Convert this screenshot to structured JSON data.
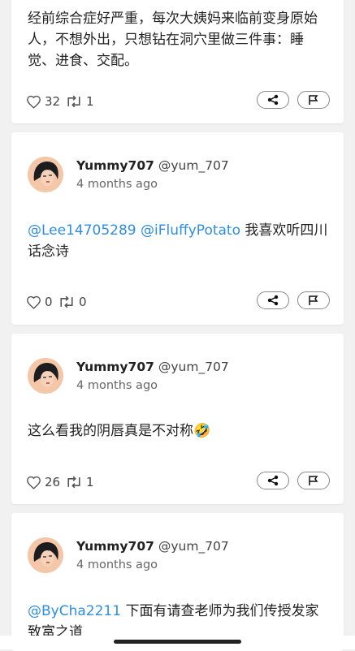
{
  "card0": {
    "text": "经前综合症好严重，每次大姨妈来临前变身原始人，不想外出，只想钻在洞穴里做三件事：睡觉、进食、交配。",
    "likes": "32",
    "reposts": "1"
  },
  "posts": [
    {
      "author_name": "Yummy707",
      "author_handle": "@yum_707",
      "time": "4 months ago",
      "mention1": "@Lee14705289",
      "mention2": "@iFluffyPotato",
      "text": "我喜欢听四川话念诗",
      "likes": "0",
      "reposts": "0"
    },
    {
      "author_name": "Yummy707",
      "author_handle": "@yum_707",
      "time": "4 months ago",
      "text": "这么看我的阴唇真是不对称🤣",
      "likes": "26",
      "reposts": "1"
    },
    {
      "author_name": "Yummy707",
      "author_handle": "@yum_707",
      "time": "4 months ago",
      "mention1": "@ByCha2211",
      "text": "下面有请查老师为我们传授发家致富之道",
      "likes": "",
      "reposts": ""
    }
  ],
  "colors": {
    "mention": "#2e8ee0",
    "background": "#f1f1f2"
  },
  "icons": {
    "like": "heart-icon",
    "repost": "repost-icon",
    "share": "share-icon",
    "flag": "flag-icon"
  }
}
